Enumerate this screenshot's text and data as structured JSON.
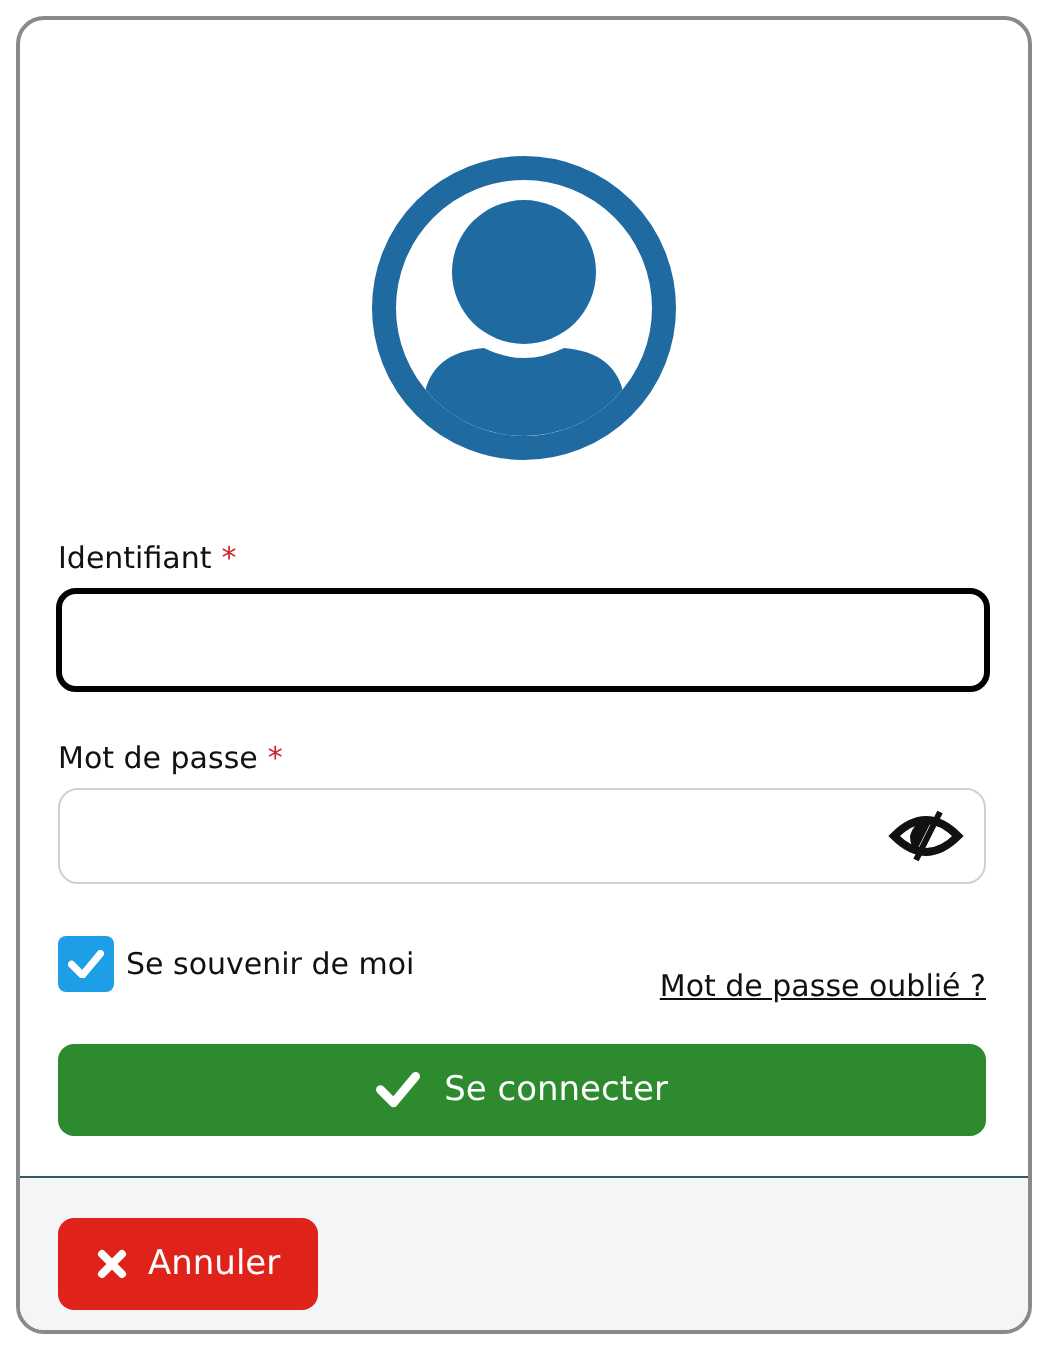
{
  "fields": [
    {
      "label": "Identifiant",
      "required_mark": "*",
      "focused": true,
      "kind": "text"
    },
    {
      "label": "Mot de passe",
      "required_mark": "*",
      "focused": false,
      "kind": "password"
    }
  ],
  "remember": {
    "label": "Se souvenir de moi",
    "checked": true
  },
  "forgot_link": "Mot de passe oublié ?",
  "submit_button": "Se connecter",
  "cancel_button": "Annuler"
}
